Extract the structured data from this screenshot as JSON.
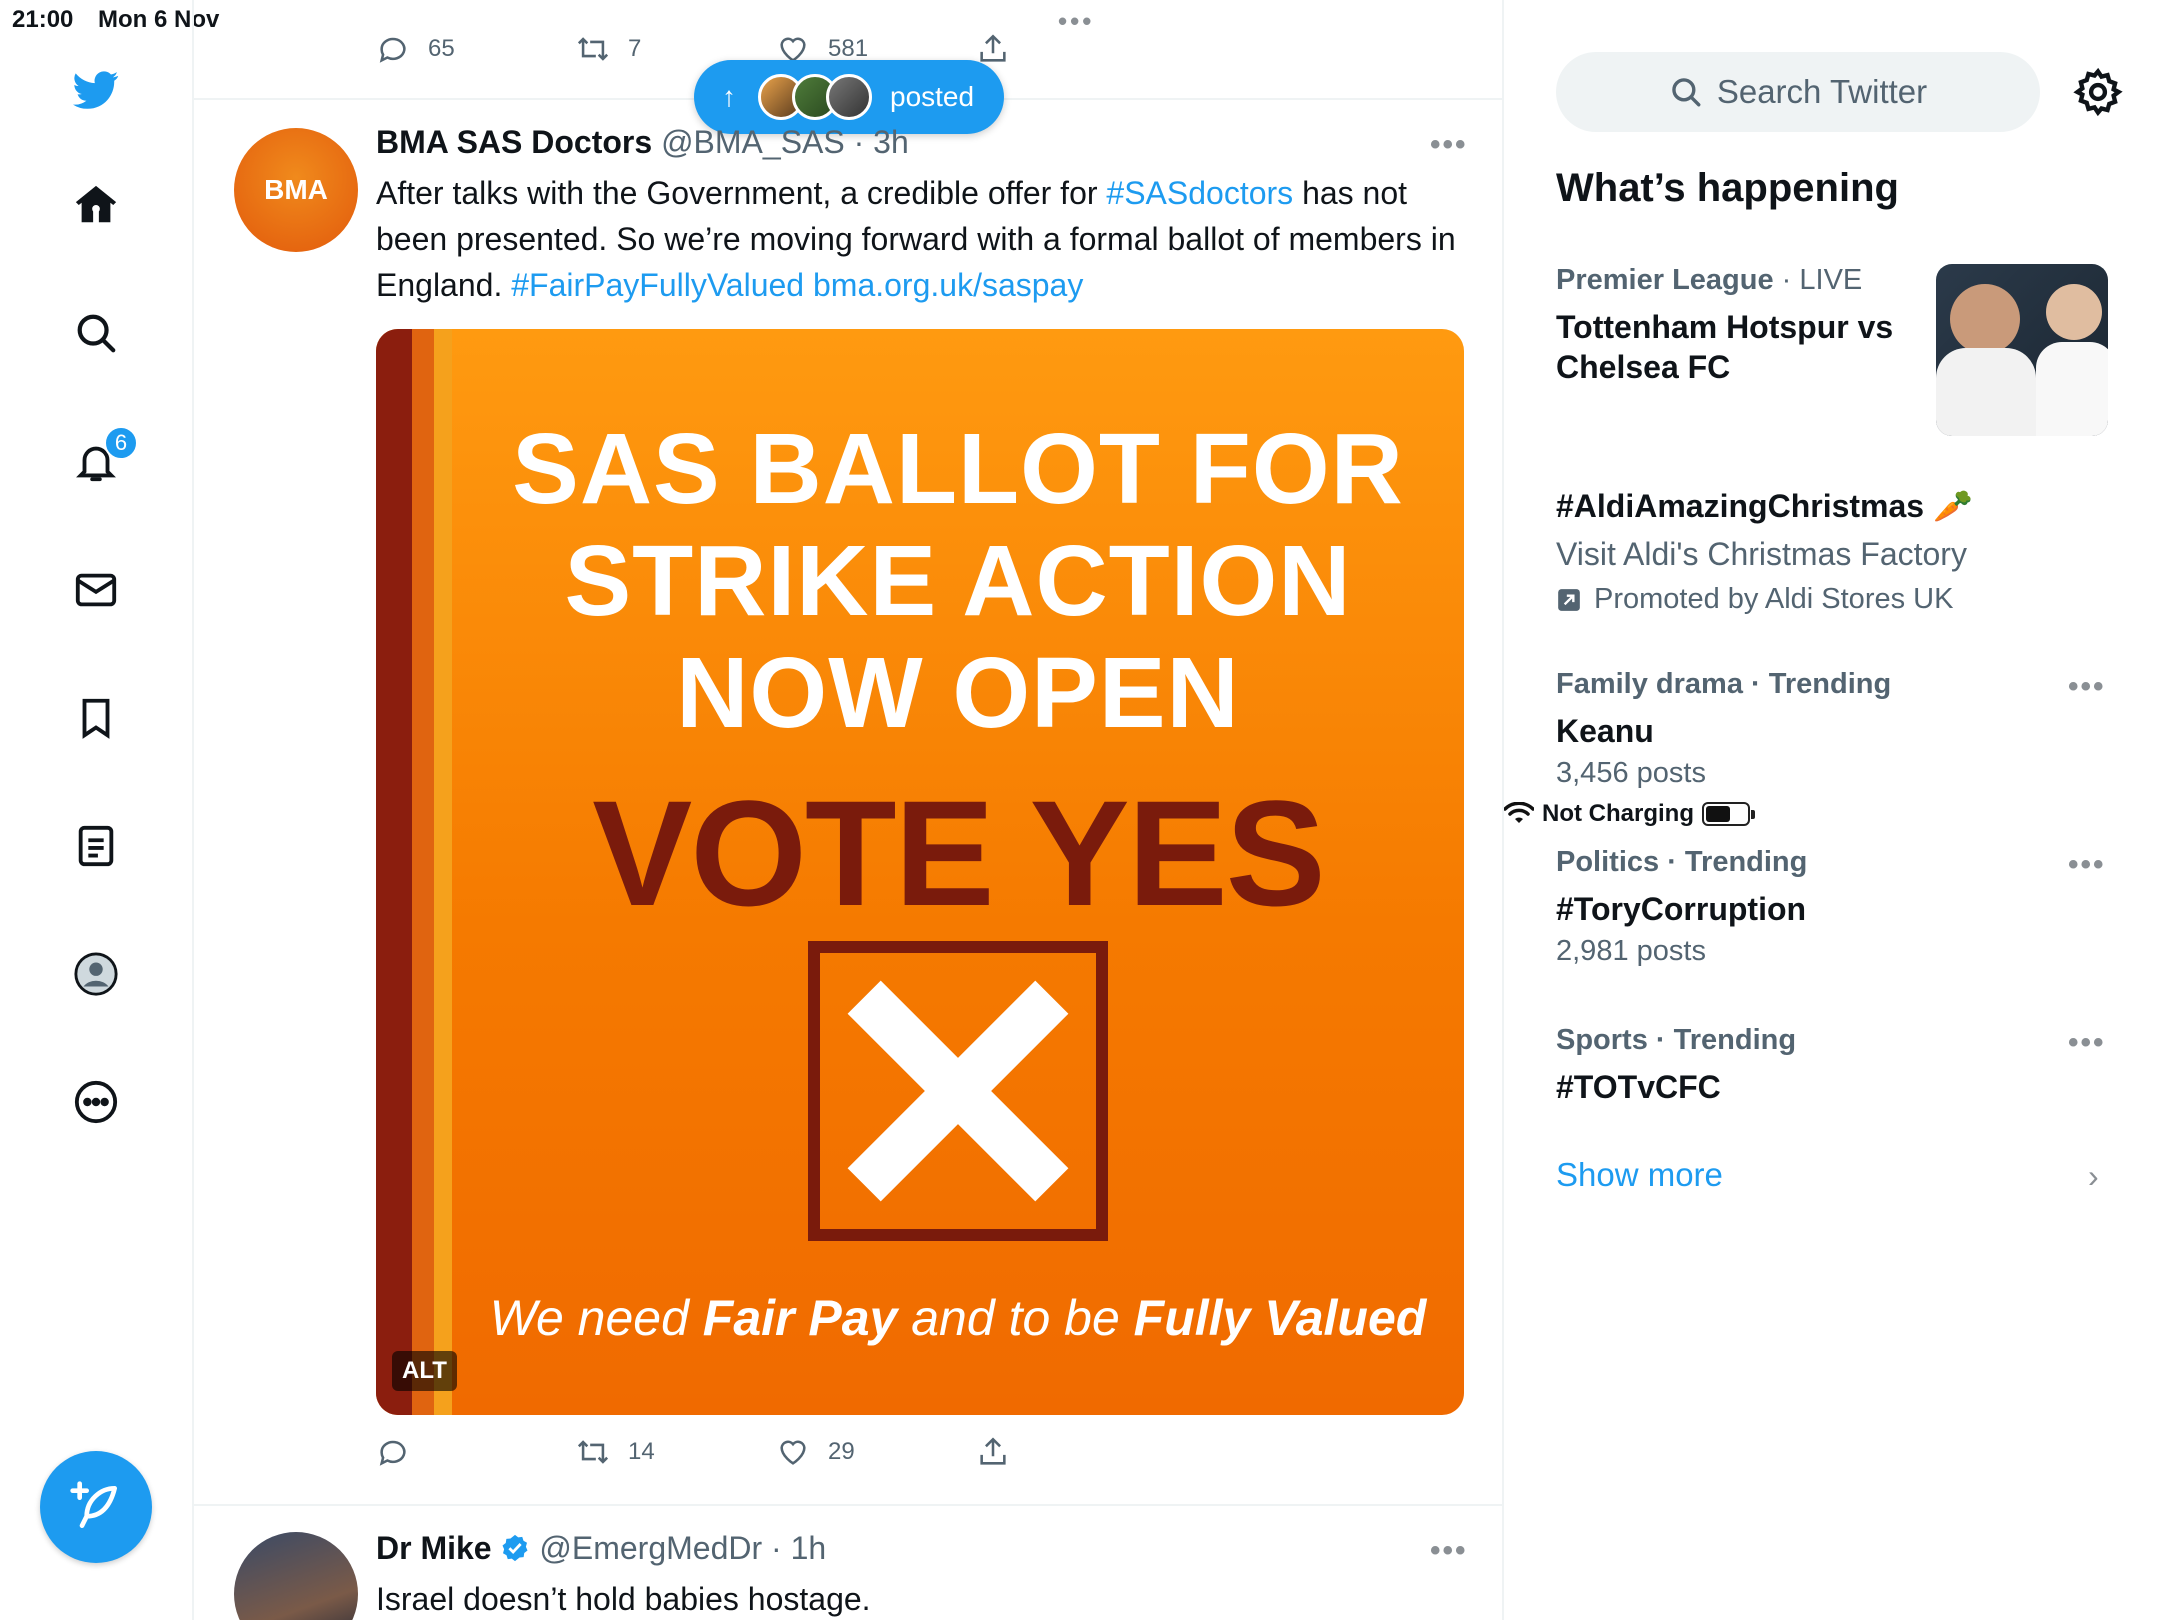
{
  "status_bar": {
    "time": "21:00",
    "date": "Mon 6 Nov",
    "charging": "Not Charging"
  },
  "sidebar": {
    "items": [
      "twitter-logo",
      "home",
      "explore",
      "notifications",
      "messages",
      "bookmarks",
      "lists",
      "profile",
      "more"
    ],
    "notification_count": "6"
  },
  "top_tweet_actions": {
    "replies": "65",
    "retweets": "7",
    "likes": "581"
  },
  "posted_pill": {
    "label": "posted"
  },
  "tweet1": {
    "name": "BMA SAS Doctors",
    "handle": "@BMA_SAS",
    "time": "· 3h",
    "avatar_text": "BMA",
    "text_1": "After talks with the Government, a credible offer for ",
    "hashtag_1": "#SASdoctors",
    "text_2": " has not been presented. So we’re moving forward with a formal ballot of members in England. ",
    "hashtag_2": "#FairPayFullyValued",
    "link": "bma.org.uk/saspay",
    "media": {
      "headline_1": "SAS BALLOT FOR",
      "headline_2": "STRIKE ACTION",
      "headline_3": "NOW OPEN",
      "vote": "VOTE YES",
      "tag_1": "We need ",
      "tag_b1": "Fair Pay",
      "tag_2": " and to be ",
      "tag_b2": "Fully Valued",
      "alt": "ALT"
    },
    "actions": {
      "replies": "",
      "retweets": "14",
      "likes": "29"
    }
  },
  "tweet2": {
    "name": "Dr Mike",
    "handle": "@EmergMedDr",
    "time": "· 1h",
    "text": "Israel doesn’t hold babies hostage."
  },
  "right": {
    "search_placeholder": "Search Twitter",
    "whats_happening": "What’s happening",
    "trends": [
      {
        "context": "Premier League",
        "context_suffix": " · LIVE",
        "title_1": "Tottenham Hotspur vs",
        "title_2": "Chelsea FC"
      },
      {
        "title": "#AldiAmazingChristmas",
        "emoji": "🥕",
        "sub": "Visit Aldi's Christmas Factory",
        "promoted": "Promoted by Aldi Stores UK"
      },
      {
        "context": "Family drama · Trending",
        "title": "Keanu",
        "sub": "3,456 posts"
      },
      {
        "context": "Politics · Trending",
        "title": "#ToryCorruption",
        "sub": "2,981 posts"
      },
      {
        "context": "Sports · Trending",
        "title": "#TOTvCFC"
      }
    ],
    "show_more": "Show more"
  },
  "colors": {
    "accent": "#1d9bf0",
    "orange": "#f57a00",
    "dark_red": "#7a1b0c"
  }
}
